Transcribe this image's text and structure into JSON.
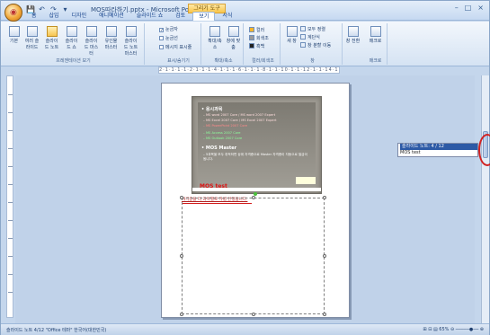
{
  "titlebar": {
    "title": "MOS따라하기.pptx - Microsoft PowerPoint",
    "context_tab": "그리기 도구",
    "minimize": "–",
    "maximize": "□",
    "close": "×"
  },
  "quick_access": [
    "💾",
    "↶",
    "↷",
    "▾"
  ],
  "tabs": [
    "홈",
    "삽입",
    "디자인",
    "애니메이션",
    "슬라이드 쇼",
    "검토",
    "보기",
    "서식"
  ],
  "active_tab": "보기",
  "ribbon": {
    "presentation_views": {
      "label": "프레젠테이션 보기",
      "buttons": [
        "기본",
        "여러 슬라이드",
        "슬라이드 노트",
        "슬라이드 쇼",
        "슬라이드 마스터",
        "유인물 마스터",
        "슬라이드 노트 마스터"
      ]
    },
    "show_hide": {
      "label": "표시/숨기기",
      "items": [
        {
          "label": "눈금자",
          "checked": true
        },
        {
          "label": "눈금선",
          "checked": false
        },
        {
          "label": "메시지 표시줄",
          "checked": false
        }
      ]
    },
    "zoom": {
      "label": "확대/축소",
      "buttons": [
        "확대/축소",
        "창에 맞춤"
      ]
    },
    "color": {
      "label": "컬러/회색조",
      "items": [
        "컬러",
        "회색조",
        "흑백"
      ]
    },
    "window": {
      "label": "창",
      "new_window": "새 창",
      "items": [
        "모두 정렬",
        "계단식",
        "창 분할 이동"
      ],
      "switch": "창 전환"
    },
    "macro": {
      "label": "매크로",
      "button": "매크로"
    }
  },
  "ruler_text": "2·1·1·1·1·2·1·1·1·4·1·1·1·6·1·1·1·8·1·1·10·1·1·12·1·1·14·1·1·16·1·1·18",
  "slide": {
    "heading": "• 응시과목",
    "lines": [
      {
        "text": "– MS word 2007 Core / MS word 2007 Expert",
        "color": "#ffdede"
      },
      {
        "text": "– MS Excel 2007 Core / MS Excel 2007 Expert",
        "color": "#ffdede"
      },
      {
        "text": "– MS PowerPoint 2007 Core",
        "color": "#ff8a8a"
      },
      {
        "text": "– MS Access 2007 Core",
        "color": "#8dff9c"
      },
      {
        "text": "– MS Outlook 2007 Core",
        "color": "#8dff9c"
      }
    ],
    "master_heading": "• MOS Master",
    "master_text": "– 5과목을 모두 취득하면 상위 자격증으로 Master 자격증이 자동으로 발급이 됩니다.",
    "footer": "MOS test"
  },
  "notes_text": "자격증을 더 과목별로 가볍 안정됩니다.",
  "tooltip": {
    "line1": "슬라이드 노트: 4 / 12",
    "line2": "MOS test"
  },
  "status": {
    "left": "슬라이드 노트 4/12   \"Office 테마\"   한국어(대한민국)",
    "right": "⊞ ⊟ ▤  65%  ⊖ ─────●── ⊕"
  }
}
